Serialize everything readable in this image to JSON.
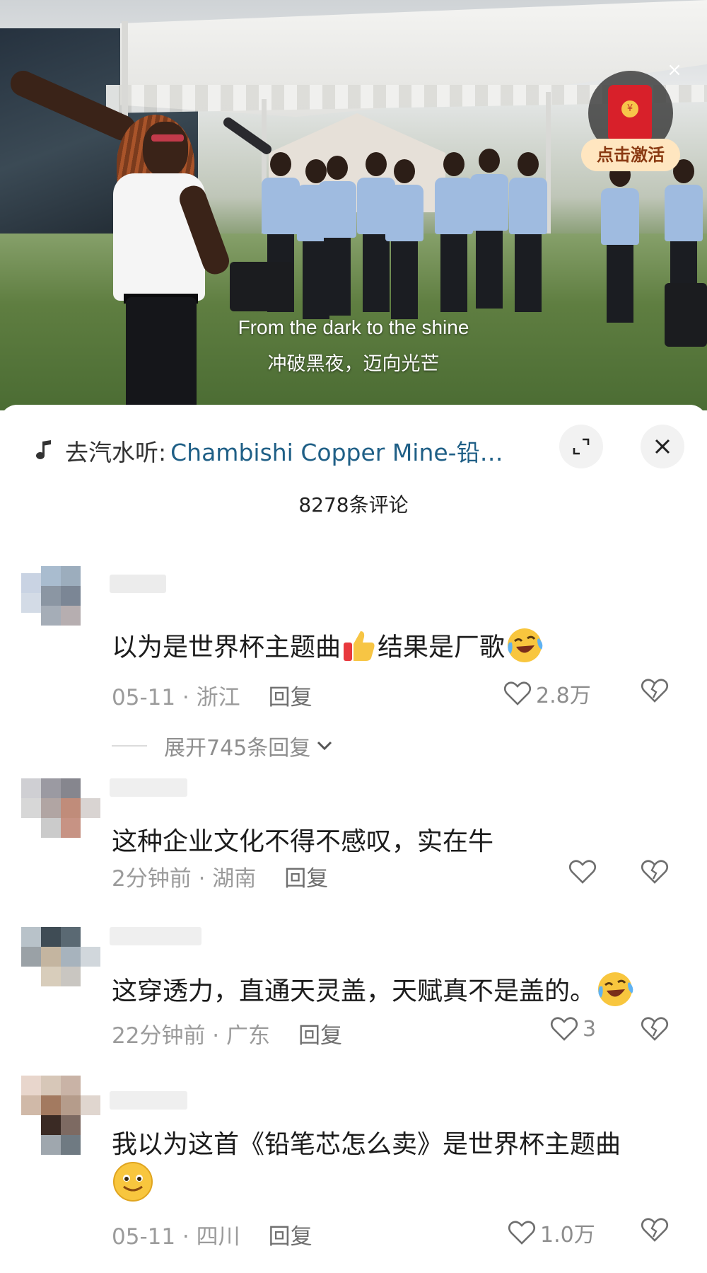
{
  "video": {
    "subtitle_en": "From the dark to the shine",
    "subtitle_cn": "冲破黑夜，迈向光芒",
    "close_symbol": "×",
    "redpack_label": "点击激活",
    "redpack_coin": "¥"
  },
  "music": {
    "prefix": "去汽水听:",
    "title": "Chambishi Copper Mine-铅…",
    "icon": "music-note-icon"
  },
  "panel": {
    "comment_count": "8278条评论",
    "expand_icon": "expand-icon",
    "close_icon": "close-icon"
  },
  "comments": [
    {
      "text_a": "以为是世界杯主题曲",
      "text_b": "结果是厂歌",
      "date": "05-11 · 浙江",
      "reply": "回复",
      "likes": "2.8万",
      "expand_text": "展开745条回复"
    },
    {
      "text": "这种企业文化不得不感叹，实在牛",
      "date": "2分钟前 · 湖南",
      "reply": "回复",
      "likes": ""
    },
    {
      "text": "这穿透力，直通天灵盖，天赋真不是盖的。",
      "date": "22分钟前 · 广东",
      "reply": "回复",
      "likes": "3"
    },
    {
      "text": "我以为这首《铅笔芯怎么卖》是世界杯主题曲",
      "date": "05-11 · 四川",
      "reply": "回复",
      "likes": "1.0万"
    }
  ],
  "colors": {
    "link": "#1f5f86",
    "meta": "#9b9b9b",
    "redpack": "#d8202a"
  }
}
